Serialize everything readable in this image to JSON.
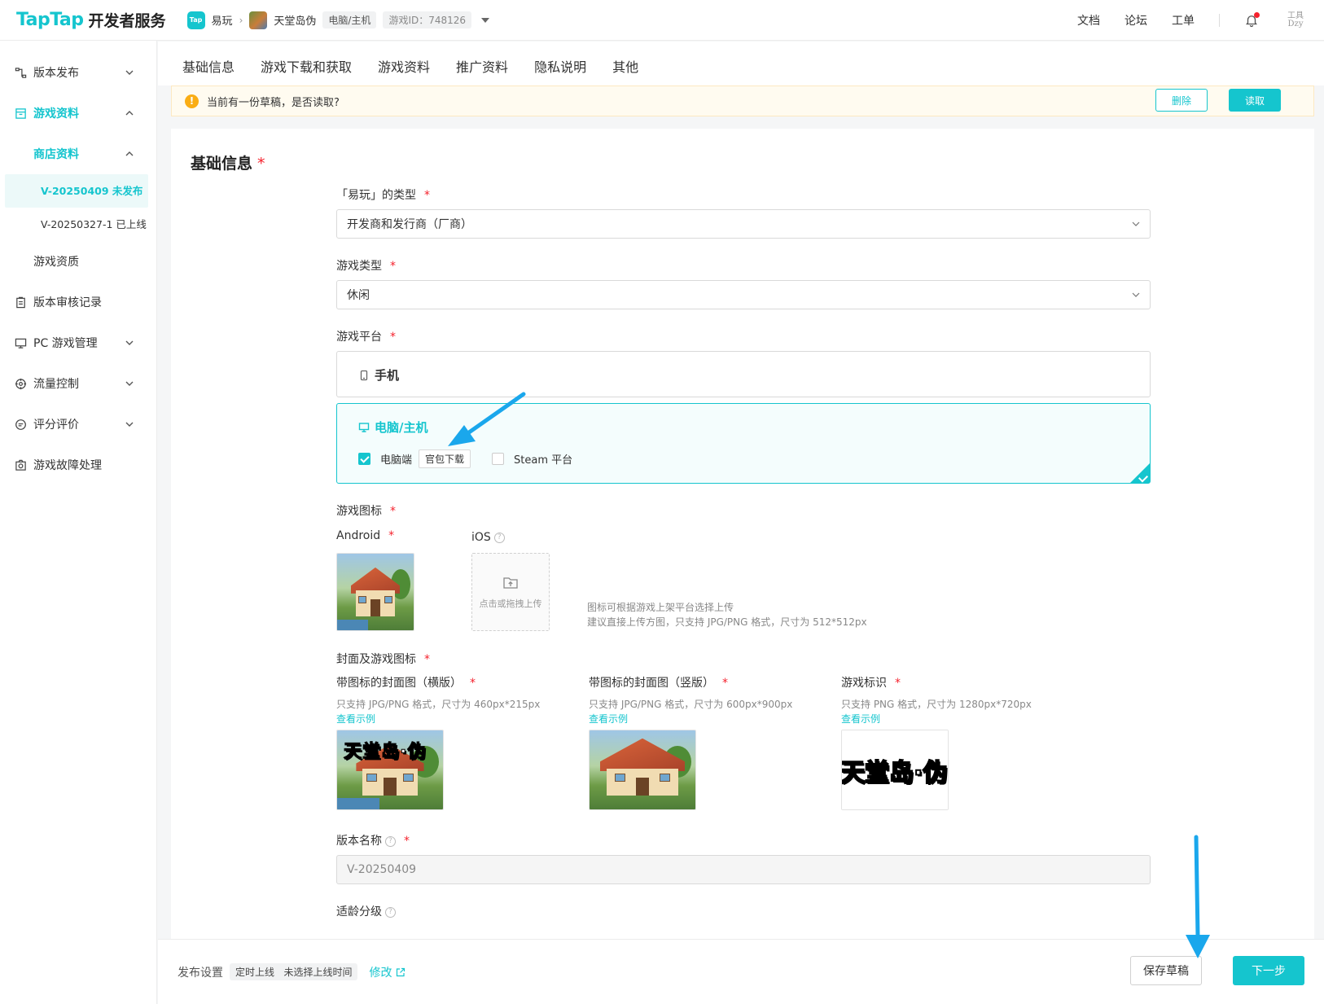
{
  "header": {
    "logo": "TapTap",
    "logo_sub": "开发者服务",
    "tap_tag": "Tap",
    "brand": "易玩",
    "game_name": "天堂岛伪",
    "platform_tag": "电脑/主机",
    "game_id": "游戏ID：748126",
    "links": [
      "文档",
      "论坛",
      "工单"
    ],
    "user_sign": "工具 Dzy"
  },
  "sidebar": {
    "items": [
      {
        "label": "版本发布"
      },
      {
        "label": "游戏资料"
      },
      {
        "label": "商店资料"
      },
      {
        "label": "V-20250409 未发布"
      },
      {
        "label": "V-20250327-1 已上线"
      },
      {
        "label": "游戏资质"
      },
      {
        "label": "版本审核记录"
      },
      {
        "label": "PC 游戏管理"
      },
      {
        "label": "流量控制"
      },
      {
        "label": "评分评价"
      },
      {
        "label": "游戏故障处理"
      }
    ]
  },
  "tabs": [
    "基础信息",
    "游戏下载和获取",
    "游戏资料",
    "推广资料",
    "隐私说明",
    "其他"
  ],
  "draft": {
    "text": "当前有一份草稿，是否读取?",
    "delete_label": "删除",
    "read_label": "读取"
  },
  "form": {
    "section_title": "基础信息",
    "required_mark": "*",
    "yiwan_type_label": "「易玩」的类型",
    "yiwan_type_value": "开发商和发行商（厂商）",
    "game_type_label": "游戏类型",
    "game_type_value": "休闲",
    "platform_label": "游戏平台",
    "platform_mobile": "手机",
    "platform_pc": "电脑/主机",
    "pc_option": "电脑端",
    "pc_option_tag": "官包下载",
    "steam_option": "Steam 平台",
    "icon_label": "游戏图标",
    "android_label": "Android",
    "ios_label": "iOS",
    "upload_text": "点击或拖拽上传",
    "icon_hint_1": "图标可根据游戏上架平台选择上传",
    "icon_hint_2": "建议直接上传方图，只支持 JPG/PNG 格式，尺寸为 512*512px",
    "cover_section_label": "封面及游戏图标",
    "cover_h_label": "带图标的封面图（横版）",
    "cover_h_hint": "只支持 JPG/PNG 格式，尺寸为 460px*215px",
    "cover_v_label": "带图标的封面图（竖版）",
    "cover_v_hint": "只支持 JPG/PNG 格式，尺寸为 600px*900px",
    "logo_label": "游戏标识",
    "logo_hint": "只支持 PNG 格式，尺寸为 1280px*720px",
    "example_link": "查看示例",
    "cover_title_text": "天堂岛·伪",
    "logo_mark_text": "天堂岛·伪",
    "version_name_label": "版本名称",
    "version_name_value": "V-20250409",
    "age_rating_label": "适龄分级"
  },
  "footer": {
    "publish_label": "发布设置",
    "publish_tag": "定时上线   未选择上线时间",
    "edit_label": "修改",
    "save_label": "保存草稿",
    "next_label": "下一步"
  },
  "colors": {
    "accent": "#15c5ce",
    "required": "#f5222d",
    "warning": "#faad14",
    "arrow": "#1aa7ec"
  }
}
